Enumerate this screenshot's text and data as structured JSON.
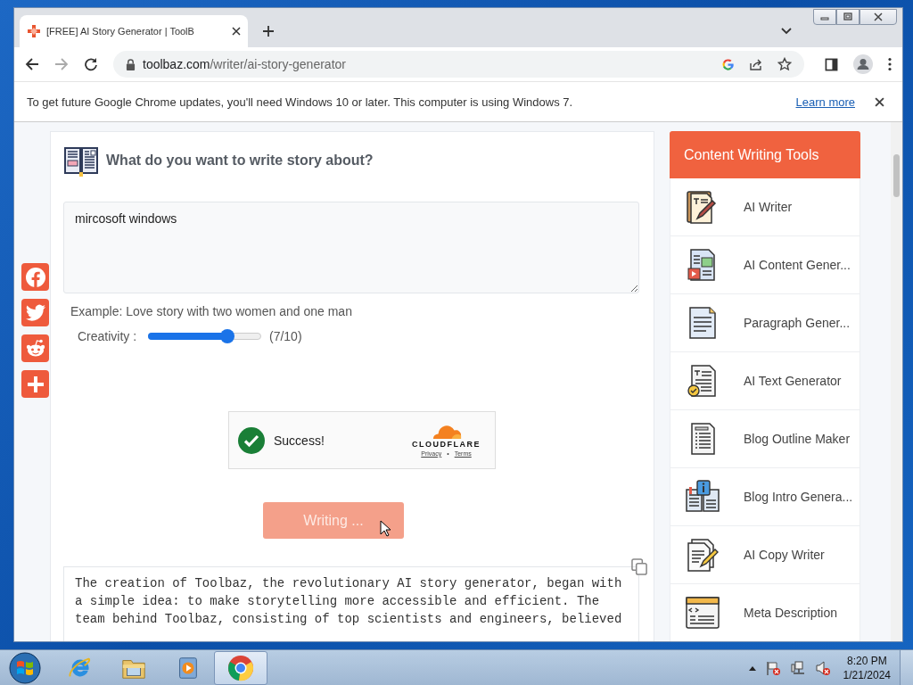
{
  "browser": {
    "tab_title": "[FREE] AI Story Generator | ToolB",
    "url_host": "toolbaz.com",
    "url_path": "/writer/ai-story-generator"
  },
  "infobar": {
    "message": "To get future Google Chrome updates, you'll need Windows 10 or later. This computer is using Windows 7.",
    "link": "Learn more"
  },
  "prompt": {
    "heading": "What do you want to write story about?",
    "value": "mircosoft windows",
    "example": "Example: Love story with two women and one man"
  },
  "creativity": {
    "label": "Creativity :",
    "level": 0.7,
    "reading": "(7/10)"
  },
  "captcha": {
    "status": "Success!",
    "brand": "CLOUDFLARE",
    "privacy": "Privacy",
    "separator": "•",
    "terms": "Terms"
  },
  "submit": {
    "label": "Writing ...",
    "disabled": true
  },
  "output": {
    "lines": [
      "The creation of Toolbaz, the revolutionary AI story generator, began with",
      "a simple idea: to make storytelling more accessible and efficient. The",
      "team behind Toolbaz, consisting of top scientists and engineers, believed"
    ]
  },
  "sidebar": {
    "title": "Content Writing Tools",
    "items": [
      {
        "label": "AI Writer"
      },
      {
        "label": "AI Content Gener..."
      },
      {
        "label": "Paragraph Gener..."
      },
      {
        "label": "AI Text Generator"
      },
      {
        "label": "Blog Outline Maker"
      },
      {
        "label": "Blog Intro Genera..."
      },
      {
        "label": "AI Copy Writer"
      },
      {
        "label": "Meta Description"
      }
    ]
  },
  "taskbar": {
    "time": "8:20 PM",
    "date": "1/21/2024"
  }
}
